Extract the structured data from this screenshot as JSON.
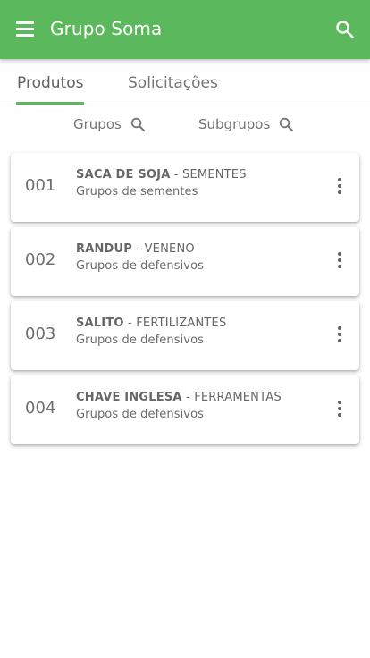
{
  "colors": {
    "primary": "#5cb85c",
    "appbar_text": "#ffffff",
    "text": "#616161"
  },
  "appbar": {
    "title": "Grupo Soma",
    "menu_icon": "hamburger-menu-icon",
    "search_icon": "search-icon"
  },
  "tabs": [
    {
      "label": "Produtos",
      "active": true
    },
    {
      "label": "Solicitações",
      "active": false
    }
  ],
  "filters": [
    {
      "label": "Grupos",
      "icon": "search-icon"
    },
    {
      "label": "Subgrupos",
      "icon": "search-icon"
    }
  ],
  "products": [
    {
      "code": "001",
      "name": "SACA DE SOJA",
      "separator": " - ",
      "category": "SEMENTES",
      "group": "Grupos de sementes"
    },
    {
      "code": "002",
      "name": "RANDUP",
      "separator": " - ",
      "category": "VENENO",
      "group": "Grupos de defensivos"
    },
    {
      "code": "003",
      "name": "SALITO",
      "separator": " - ",
      "category": "FERTILIZANTES",
      "group": "Grupos de defensivos"
    },
    {
      "code": "004",
      "name": "CHAVE INGLESA",
      "separator": " - ",
      "category": "FERRAMENTAS",
      "group": "Grupos de defensivos"
    }
  ]
}
